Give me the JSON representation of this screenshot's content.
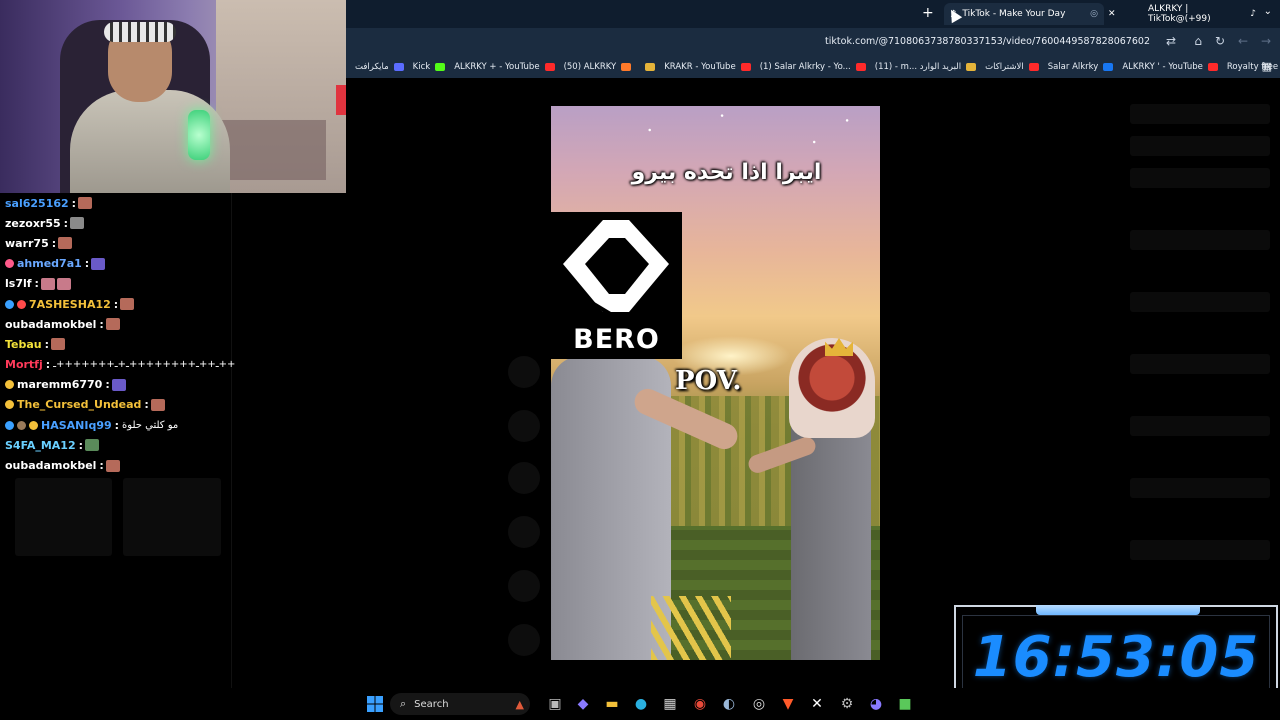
{
  "browser": {
    "tabs": [
      {
        "title": "TikTok - Make Your Day",
        "active": true
      },
      {
        "title": "ALKRKY | TikTok@(+99)",
        "active": false
      }
    ],
    "address": "tiktok.com/@7108063738780337153/video/7600449587828067602",
    "bookmarks": [
      {
        "label": "مايكرافت",
        "color": "#5b6cff"
      },
      {
        "label": "Kick",
        "color": "#53fc18"
      },
      {
        "label": "ALKRKY + - YouTube",
        "color": "#ff2a2a"
      },
      {
        "label": "(50) ALKRKY",
        "color": "#ff7a2a"
      },
      {
        "label": "",
        "color": "#e5b43a"
      },
      {
        "label": "KRAKR - YouTube",
        "color": "#ff2a2a"
      },
      {
        "label": "(1) Salar Alkrky - Yo...",
        "color": "#ff2a2a"
      },
      {
        "label": "(11) - m... البريد الوارد",
        "color": "#e5b43a"
      },
      {
        "label": "الاشتراكات",
        "color": "#ff2a2a"
      },
      {
        "label": "Salar Alkrky",
        "color": "#1877f2"
      },
      {
        "label": "ALKRKY ' - YouTube",
        "color": "#ff2a2a"
      },
      {
        "label": "Royalty free music |...",
        "color": "#e6ecf3"
      }
    ]
  },
  "chat": {
    "messages": [
      {
        "user": "sal625162",
        "color": "#4aa0ff",
        "badges": [],
        "emotes": [
          "#b56a5a"
        ],
        "text": ""
      },
      {
        "user": "zezoxr55",
        "color": "#ffffff",
        "badges": [],
        "emotes": [
          "#8a8a8a"
        ],
        "text": ""
      },
      {
        "user": "warr75",
        "color": "#ffffff",
        "badges": [],
        "emotes": [
          "#b56a5a"
        ],
        "text": ""
      },
      {
        "user": "ahmed7a1",
        "color": "#6aa8ff",
        "badges": [
          "#ff5a8a"
        ],
        "emotes": [
          "#6a5ac8"
        ],
        "text": ""
      },
      {
        "user": "ls7lf",
        "color": "#ffffff",
        "badges": [],
        "emotes": [
          "#c87a8a",
          "#c87a8a"
        ],
        "text": ""
      },
      {
        "user": "7ASHESHA12",
        "color": "#f3c03a",
        "badges": [
          "#3aa0ff",
          "#ff4a4a"
        ],
        "emotes": [
          "#b56a5a"
        ],
        "text": ""
      },
      {
        "user": "oubadamokbel",
        "color": "#ffffff",
        "badges": [],
        "emotes": [
          "#b56a5a"
        ],
        "text": ""
      },
      {
        "user": "Tebau",
        "color": "#f3e23a",
        "badges": [],
        "emotes": [
          "#b56a5a"
        ],
        "text": ""
      },
      {
        "user": "Mortfj",
        "color": "#ff3a5a",
        "badges": [],
        "emotes": [],
        "text": "ـ++ـ++++++++ـ+ـ+++++++ـ++"
      },
      {
        "user": "maremm6770",
        "color": "#ffffff",
        "badges": [
          "#f3c03a"
        ],
        "emotes": [
          "#6a5ac8"
        ],
        "text": ""
      },
      {
        "user": "The_Cursed_Undead",
        "color": "#f3c03a",
        "badges": [
          "#f3c03a"
        ],
        "emotes": [
          "#b56a5a"
        ],
        "text": ""
      },
      {
        "user": "HASANIq99",
        "color": "#4aa0ff",
        "badges": [
          "#3aa0ff",
          "#9a7a5a",
          "#f3c03a"
        ],
        "emotes": [],
        "text": "مو كلتي حلوة"
      },
      {
        "user": "S4FA_MA12",
        "color": "#6ad0ff",
        "badges": [],
        "emotes": [
          "#5a8a5a"
        ],
        "text": ""
      },
      {
        "user": "oubadamokbel",
        "color": "#ffffff",
        "badges": [],
        "emotes": [
          "#b56a5a"
        ],
        "text": ""
      }
    ]
  },
  "video": {
    "caption": "ايبرا اذا تحده بيرو",
    "overlay_text": "POV."
  },
  "logo": {
    "text": "BERO"
  },
  "clock": {
    "time": "16:53:05",
    "color": "#1a8cff"
  },
  "taskbar": {
    "search_label": "Search",
    "icons": [
      "windows-start-icon",
      "widgets-icon",
      "task-view-icon",
      "copilot-icon",
      "file-explorer-icon",
      "edge-icon",
      "store-icon",
      "chrome-icon",
      "steam-icon",
      "obs-icon",
      "brave-icon",
      "capcut-icon",
      "settings-icon",
      "discord-icon",
      "minecraft-icon"
    ]
  }
}
